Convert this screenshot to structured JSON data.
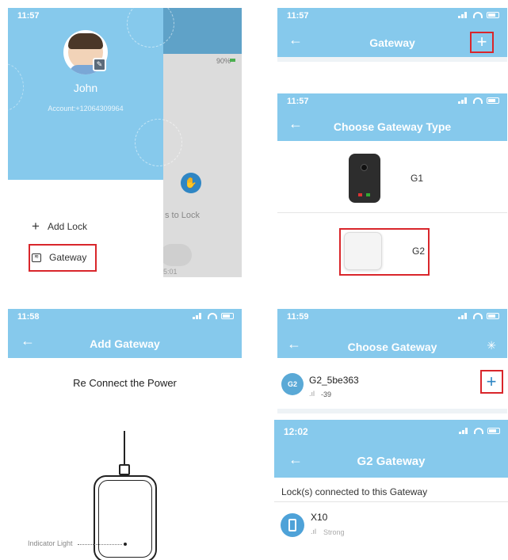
{
  "p1": {
    "time": "11:57",
    "user_name": "John",
    "account": "Account:+12064309964",
    "battery_pct": "90%",
    "bg_hint": "s to Lock",
    "bg_time": "5:01",
    "menu": {
      "add_lock": "Add Lock",
      "gateway": "Gateway"
    }
  },
  "p2": {
    "time": "11:57",
    "title": "Gateway"
  },
  "p3": {
    "time": "11:57",
    "title": "Choose Gateway Type",
    "options": [
      {
        "label": "G1"
      },
      {
        "label": "G2"
      }
    ]
  },
  "p4": {
    "time": "11:58",
    "title": "Add Gateway",
    "instruction": "Re Connect the Power",
    "indicator": "Indicator Light"
  },
  "p5": {
    "time": "11:59",
    "title": "Choose Gateway",
    "gateway_name": "G2_5be363",
    "gateway_icon": "G2",
    "rssi": "-39"
  },
  "p6": {
    "time": "12:02",
    "title": "G2  Gateway",
    "section": "Lock(s) connected to this Gateway",
    "lock_name": "X10",
    "lock_signal": "Strong"
  },
  "colors": {
    "header": "#86c9ec",
    "highlight": "#d9262b"
  }
}
